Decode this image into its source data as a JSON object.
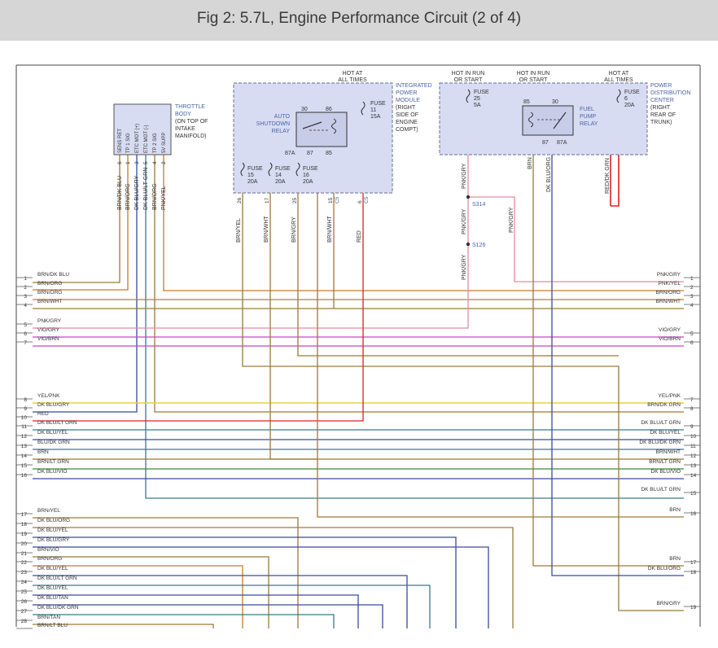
{
  "title": "Fig 2: 5.7L, Engine Performance Circuit (2 of 4)",
  "throttle_body": {
    "lines": [
      "THROTTLE",
      "BODY",
      "(ON TOP OF",
      "INTAKE",
      "MANIFOLD)"
    ],
    "pins": [
      {
        "name": "SENS RET",
        "pin": "6",
        "wire": "BRN/DK BLU"
      },
      {
        "name": "TP 1 SIG",
        "pin": "1",
        "wire": "BRN/ORG"
      },
      {
        "name": "ETC MOT (+)",
        "pin": "3",
        "wire": "DK BLU/GRY"
      },
      {
        "name": "ETC MOT (-)",
        "pin": "5",
        "wire": "DK BLU/LT GRN"
      },
      {
        "name": "TP 2 SIG",
        "pin": "4",
        "wire": "BRN/ORG"
      },
      {
        "name": "5V SUPP",
        "pin": "2",
        "wire": "PNK/YEL"
      }
    ]
  },
  "ipm": {
    "lines": [
      "INTEGRATED",
      "POWER",
      "MODULE",
      "(RIGHT",
      "SIDE OF",
      "ENGINE",
      "COMPT)"
    ],
    "hot": [
      "HOT AT",
      "ALL TIMES"
    ],
    "relay": {
      "lines": [
        "AUTO",
        "SHUTDOWN",
        "RELAY"
      ],
      "pins": [
        "30",
        "86",
        "87A",
        "87",
        "85"
      ]
    },
    "fuses": [
      {
        "label": "FUSE",
        "num": "15",
        "amp": "20A"
      },
      {
        "label": "FUSE",
        "num": "14",
        "amp": "20A"
      },
      {
        "label": "FUSE",
        "num": "16",
        "amp": "20A"
      },
      {
        "label": "FUSE",
        "num": "11",
        "amp": "15A"
      }
    ],
    "out_pins": [
      "26",
      "17",
      "25",
      "15",
      "6"
    ],
    "conn_marks": [
      "C5",
      "C5"
    ],
    "wires": [
      "BRN/YEL",
      "BRN/WHT",
      "BRN/GRY",
      "BRN/WHT",
      "RED"
    ]
  },
  "pdc": {
    "lines": [
      "POWER",
      "DISTRIBUTION",
      "CENTER",
      "(RIGHT",
      "REAR OF",
      "TRUNK)"
    ],
    "hot_run1": [
      "HOT IN RUN",
      "OR START"
    ],
    "hot_run2": [
      "HOT IN RUN",
      "OR START"
    ],
    "hot_all": [
      "HOT AT",
      "ALL TIMES"
    ],
    "fuse25": {
      "label": "FUSE",
      "num": "25",
      "amp": "5A"
    },
    "fuse6": {
      "label": "FUSE",
      "num": "6",
      "amp": "20A"
    },
    "relay": {
      "lines": [
        "FUEL",
        "PUMP",
        "RELAY"
      ],
      "pins": [
        "85",
        "30",
        "87",
        "87A"
      ]
    },
    "wires": [
      "PNK/GRY",
      "BRN",
      "DK BLU/ORG",
      "RED/DK GRN"
    ]
  },
  "splices": {
    "s314": "S314",
    "s126": "S126",
    "wire_a": "PNK/GRY",
    "wire_b": "PNK/GRY",
    "wire_c": "PNK/GRY"
  },
  "left_connector": [
    {
      "pin": "1",
      "wire": "BRN/DK BLU"
    },
    {
      "pin": "2",
      "wire": "BRN/ORG"
    },
    {
      "pin": "3",
      "wire": "BRN/ORG"
    },
    {
      "pin": "4",
      "wire": "BRN/WHT"
    },
    {
      "pin": "5",
      "wire": "PNK/GRY"
    },
    {
      "pin": "6",
      "wire": "VIO/GRY"
    },
    {
      "pin": "7",
      "wire": "VIO/BRN"
    },
    {
      "pin": "8",
      "wire": "YEL/PNK"
    },
    {
      "pin": "9",
      "wire": "DK BLU/GRY"
    },
    {
      "pin": "10",
      "wire": "RED"
    },
    {
      "pin": "11",
      "wire": "DK BLU/LT GRN"
    },
    {
      "pin": "12",
      "wire": "DK BLU/YEL"
    },
    {
      "pin": "13",
      "wire": "BLU/DK GRN"
    },
    {
      "pin": "14",
      "wire": "BRN"
    },
    {
      "pin": "15",
      "wire": "BRN/LT GRN"
    },
    {
      "pin": "16",
      "wire": "DK BLU/VIO"
    },
    {
      "pin": "17",
      "wire": "BRN/YEL"
    },
    {
      "pin": "18",
      "wire": "DK BLU/ORG"
    },
    {
      "pin": "19",
      "wire": "DK BLU/YEL"
    },
    {
      "pin": "20",
      "wire": "DK BLU/GRY"
    },
    {
      "pin": "21",
      "wire": "BRN/VIO"
    },
    {
      "pin": "22",
      "wire": "BRN/ORG"
    },
    {
      "pin": "23",
      "wire": "DK BLU/YEL"
    },
    {
      "pin": "24",
      "wire": "DK BLU/LT GRN"
    },
    {
      "pin": "25",
      "wire": "DK BLU/YEL"
    },
    {
      "pin": "26",
      "wire": "DK BLU/TAN"
    },
    {
      "pin": "27",
      "wire": "DK BLU/DK GRN"
    },
    {
      "pin": "28",
      "wire": "BRN/TAN"
    },
    {
      "pin": "",
      "wire": "BRN/LT BLU"
    }
  ],
  "right_connector": [
    {
      "pin": "1",
      "wire": "PNK/GRY"
    },
    {
      "pin": "2",
      "wire": "PNK/YEL"
    },
    {
      "pin": "3",
      "wire": "BRN/ORG"
    },
    {
      "pin": "4",
      "wire": "BRN/WHT"
    },
    {
      "pin": "5",
      "wire": "VIO/GRY"
    },
    {
      "pin": "6",
      "wire": "VIO/BRN"
    },
    {
      "pin": "7",
      "wire": "YEL/PNK"
    },
    {
      "pin": "8",
      "wire": "BRN/DK GRN"
    },
    {
      "pin": "9",
      "wire": "DK BLU/LT GRN"
    },
    {
      "pin": "10",
      "wire": "DK BLU/YEL"
    },
    {
      "pin": "11",
      "wire": "DK BLU/DK GRN"
    },
    {
      "pin": "12",
      "wire": "BRN/WHT"
    },
    {
      "pin": "13",
      "wire": "BRN/LT GRN"
    },
    {
      "pin": "14",
      "wire": "DK BLU/VIO"
    },
    {
      "pin": "15",
      "wire": "DK BLU/LT GRN"
    },
    {
      "pin": "16",
      "wire": "BRN"
    },
    {
      "pin": "17",
      "wire": "BRN"
    },
    {
      "pin": "18",
      "wire": "DK BLU/ORG"
    },
    {
      "pin": "19",
      "wire": "BRN/GRY"
    }
  ],
  "colors": {
    "title_bg": "#d6d6d6",
    "module_box": "#d8dcf2",
    "module_border": "#7f86a8",
    "module_label": "#4a63a8",
    "wire_brown": "#9a7a3a",
    "wire_orange": "#c87a2a",
    "wire_pink": "#e88aa0",
    "wire_violet": "#d040c8",
    "wire_yellow": "#e8d040",
    "wire_red": "#e02020",
    "wire_blue": "#3a4aa0",
    "wire_green": "#3a8a3a",
    "wire_teal": "#3a7a8a",
    "wire_gray": "#808080"
  }
}
